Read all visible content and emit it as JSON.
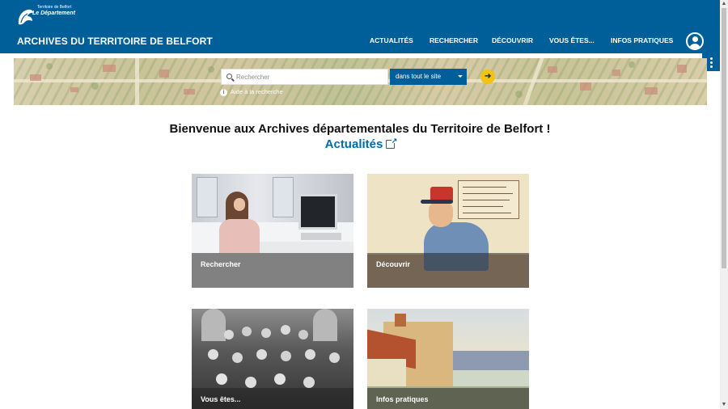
{
  "header": {
    "logo": {
      "top_text": "Territoire de Belfort",
      "bottom_text": "Le Département"
    },
    "site_title": "ARCHIVES DU TERRITOIRE DE BELFORT",
    "nav": [
      "ACTUALITÉS",
      "RECHERCHER",
      "DÉCOUVRIR",
      "VOUS ÊTES...",
      "INFOS PRATIQUES"
    ],
    "user_icon": "user-account-icon"
  },
  "search": {
    "placeholder": "Rechercher",
    "value": "",
    "scope": "dans tout le site",
    "go_icon": "arrow-right-icon",
    "advanced_label": "Aide à la recherche"
  },
  "main": {
    "welcome": "Bienvenue aux Archives départementales du Territoire de Belfort !",
    "news_link": "Actualités",
    "cards": [
      "Rechercher",
      "Découvrir",
      "Vous êtes...",
      "Infos pratiques"
    ]
  },
  "colors": {
    "header_bg": "#005f98",
    "link": "#006ba6",
    "go_button": "#f1c40f"
  }
}
